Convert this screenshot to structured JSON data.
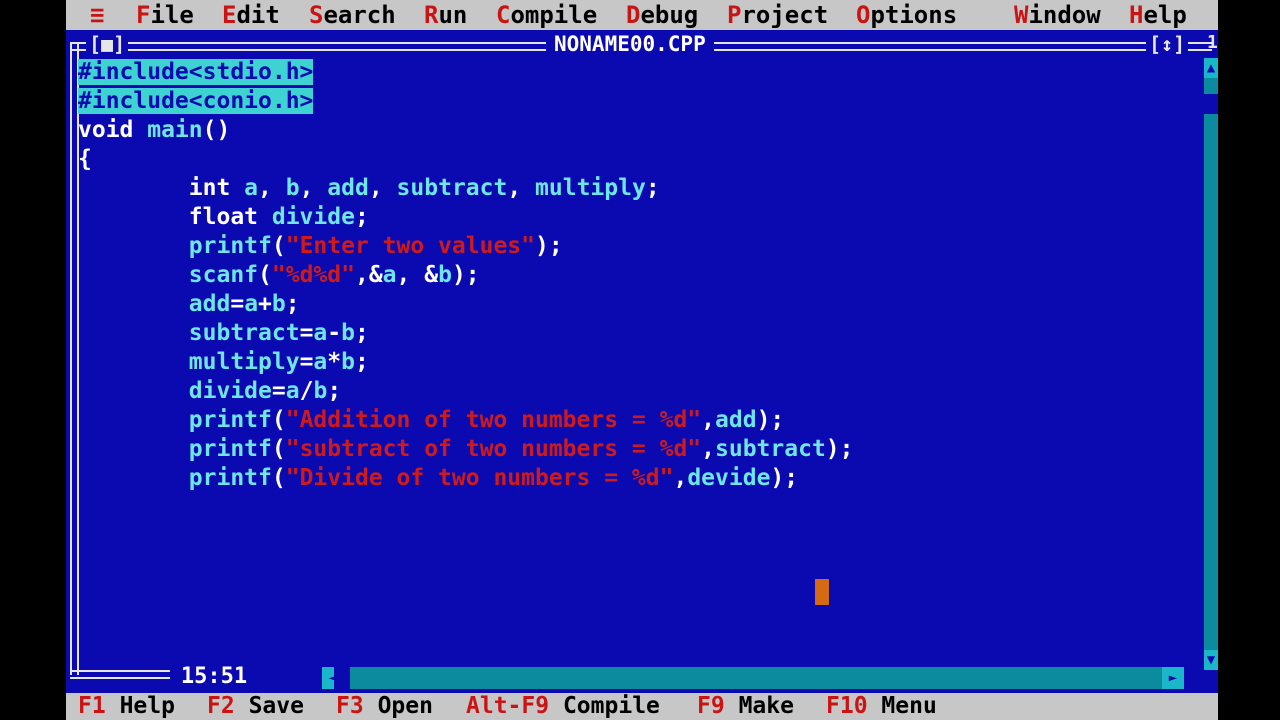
{
  "menu": [
    {
      "hotkey": "≡",
      "rest": ""
    },
    {
      "hotkey": "F",
      "rest": "ile"
    },
    {
      "hotkey": "E",
      "rest": "dit"
    },
    {
      "hotkey": "S",
      "rest": "earch"
    },
    {
      "hotkey": "R",
      "rest": "un"
    },
    {
      "hotkey": "C",
      "rest": "ompile"
    },
    {
      "hotkey": "D",
      "rest": "ebug"
    },
    {
      "hotkey": "P",
      "rest": "roject"
    },
    {
      "hotkey": "O",
      "rest": "ptions"
    },
    {
      "hotkey": "W",
      "rest": "indow"
    },
    {
      "hotkey": "H",
      "rest": "elp"
    }
  ],
  "window": {
    "title": "NONAME00.CPP",
    "close_box": "[■]",
    "zoom_box": "[↕]",
    "number": "1"
  },
  "code": {
    "lines": [
      [
        {
          "t": "#include<stdio.h>",
          "c": "pp"
        }
      ],
      [
        {
          "t": "#include<conio.h>",
          "c": "pp"
        }
      ],
      [
        {
          "t": "void",
          "c": "kw"
        },
        {
          "t": " main",
          "c": "id"
        },
        {
          "t": "()",
          "c": "op"
        }
      ],
      [
        {
          "t": "{",
          "c": "op"
        }
      ],
      [
        {
          "t": "        int",
          "c": "kw"
        },
        {
          "t": " a",
          "c": "id"
        },
        {
          "t": ",",
          "c": "op"
        },
        {
          "t": " b",
          "c": "id"
        },
        {
          "t": ",",
          "c": "op"
        },
        {
          "t": " add",
          "c": "id"
        },
        {
          "t": ",",
          "c": "op"
        },
        {
          "t": " subtract",
          "c": "id"
        },
        {
          "t": ",",
          "c": "op"
        },
        {
          "t": " multiply",
          "c": "id"
        },
        {
          "t": ";",
          "c": "op"
        }
      ],
      [
        {
          "t": "        float",
          "c": "kw"
        },
        {
          "t": " divide",
          "c": "id"
        },
        {
          "t": ";",
          "c": "op"
        }
      ],
      [
        {
          "t": "        printf",
          "c": "id"
        },
        {
          "t": "(",
          "c": "op"
        },
        {
          "t": "\"Enter two values\"",
          "c": "str"
        },
        {
          "t": ");",
          "c": "op"
        }
      ],
      [
        {
          "t": "        scanf",
          "c": "id"
        },
        {
          "t": "(",
          "c": "op"
        },
        {
          "t": "\"%d%d\"",
          "c": "str"
        },
        {
          "t": ",&",
          "c": "op"
        },
        {
          "t": "a",
          "c": "id"
        },
        {
          "t": ", &",
          "c": "op"
        },
        {
          "t": "b",
          "c": "id"
        },
        {
          "t": ");",
          "c": "op"
        }
      ],
      [
        {
          "t": "        add",
          "c": "id"
        },
        {
          "t": "=",
          "c": "op"
        },
        {
          "t": "a",
          "c": "id"
        },
        {
          "t": "+",
          "c": "op"
        },
        {
          "t": "b",
          "c": "id"
        },
        {
          "t": ";",
          "c": "op"
        }
      ],
      [
        {
          "t": "        subtract",
          "c": "id"
        },
        {
          "t": "=",
          "c": "op"
        },
        {
          "t": "a",
          "c": "id"
        },
        {
          "t": "-",
          "c": "op"
        },
        {
          "t": "b",
          "c": "id"
        },
        {
          "t": ";",
          "c": "op"
        }
      ],
      [
        {
          "t": "        multiply",
          "c": "id"
        },
        {
          "t": "=",
          "c": "op"
        },
        {
          "t": "a",
          "c": "id"
        },
        {
          "t": "*",
          "c": "op"
        },
        {
          "t": "b",
          "c": "id"
        },
        {
          "t": ";",
          "c": "op"
        }
      ],
      [
        {
          "t": "        divide",
          "c": "id"
        },
        {
          "t": "=",
          "c": "op"
        },
        {
          "t": "a",
          "c": "id"
        },
        {
          "t": "/",
          "c": "op"
        },
        {
          "t": "b",
          "c": "id"
        },
        {
          "t": ";",
          "c": "op"
        }
      ],
      [
        {
          "t": "        printf",
          "c": "id"
        },
        {
          "t": "(",
          "c": "op"
        },
        {
          "t": "\"Addition of two numbers = %d\"",
          "c": "str"
        },
        {
          "t": ",",
          "c": "op"
        },
        {
          "t": "add",
          "c": "id"
        },
        {
          "t": ");",
          "c": "op"
        }
      ],
      [
        {
          "t": "        printf",
          "c": "id"
        },
        {
          "t": "(",
          "c": "op"
        },
        {
          "t": "\"subtract of two numbers = %d\"",
          "c": "str"
        },
        {
          "t": ",",
          "c": "op"
        },
        {
          "t": "subtract",
          "c": "id"
        },
        {
          "t": ");",
          "c": "op"
        }
      ],
      [
        {
          "t": "        printf",
          "c": "id"
        },
        {
          "t": "(",
          "c": "op"
        },
        {
          "t": "\"Divide of two numbers = %d\"",
          "c": "str"
        },
        {
          "t": ",",
          "c": "op"
        },
        {
          "t": "devide",
          "c": "id"
        },
        {
          "t": ");",
          "c": "op"
        }
      ]
    ]
  },
  "status": {
    "cursor_pos": "15:51"
  },
  "fkeys": [
    {
      "key": "F1",
      "label": "Help"
    },
    {
      "key": "F2",
      "label": "Save"
    },
    {
      "key": "F3",
      "label": "Open"
    },
    {
      "key": "Alt-F9",
      "label": "Compile"
    },
    {
      "key": "F9",
      "label": "Make"
    },
    {
      "key": "F10",
      "label": "Menu"
    }
  ],
  "colors": {
    "editor_bg": "#0a0ab0",
    "menu_bg": "#c7c7c7",
    "hotkey": "#c81414",
    "keyword": "#ffffff",
    "identifier": "#6fe6e6",
    "string": "#d01a1a",
    "selection": "#3fd2d2",
    "caret": "#d46a14"
  }
}
